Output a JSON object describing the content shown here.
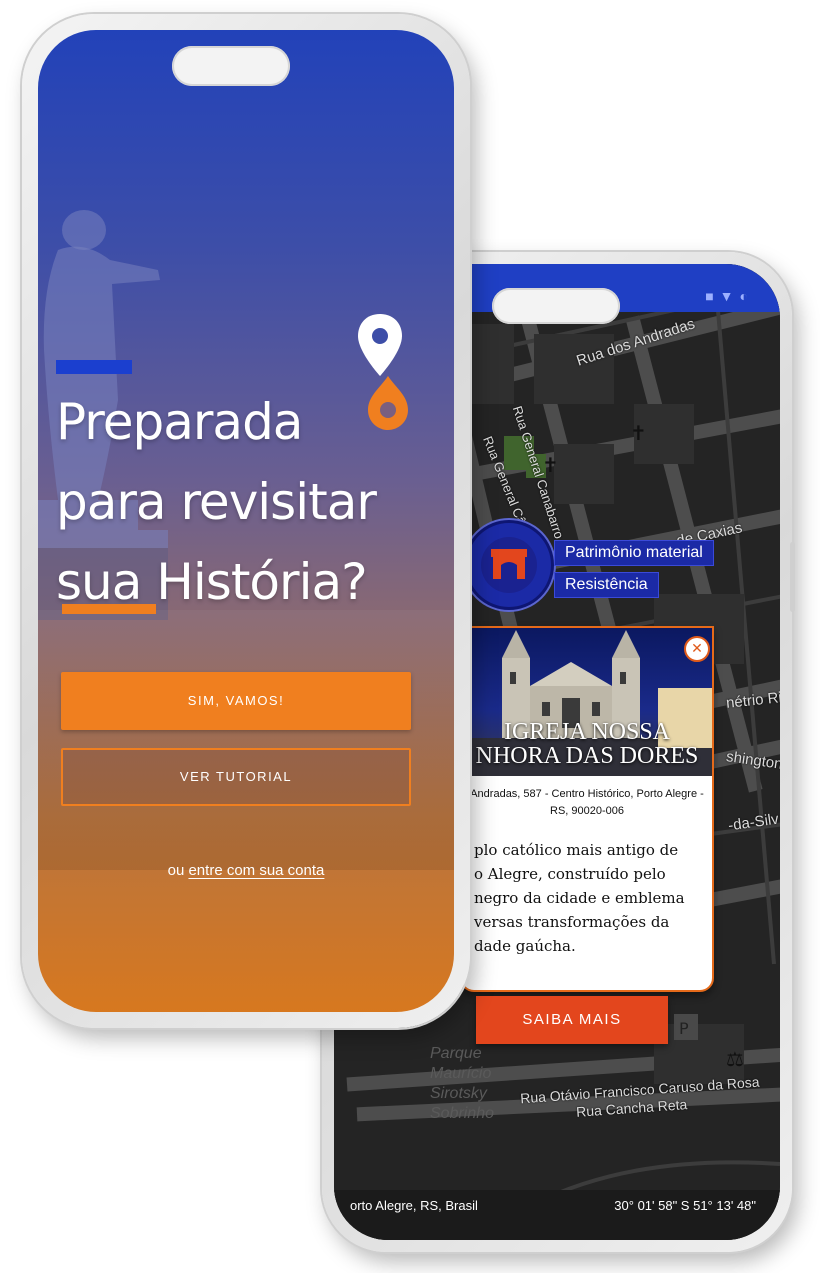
{
  "front": {
    "headline_line1": "Preparada",
    "headline_line2": "para revisitar",
    "headline_line3_a": "sua",
    "headline_line3_b": " História?",
    "primary_button": "SIM, VAMOS!",
    "secondary_button": "VER TUTORIAL",
    "login_prefix": "ou ",
    "login_link": "entre com sua conta"
  },
  "map": {
    "streets": [
      "Rua dos Andradas",
      "Rua General Canabarro",
      "Rua General Câmara",
      "de Caxias",
      "nétrio Ri",
      "shington",
      "-da-Silv",
      "Rua Otávio Francisco Caruso da Rosa",
      "Rua Cancha Reta",
      "Parque Maurício Sirotsky Sobrinho"
    ],
    "category_tags": [
      "Patrimônio material",
      "Resistência"
    ],
    "card": {
      "title_line1": "IGREJA NOSSA",
      "title_line2": "NHORA DAS DORES",
      "address": "Andradas, 587 - Centro Histórico, Porto Alegre - RS, 90020-006",
      "description": "plo católico mais antigo de\no Alegre, construído pelo\nnegro da cidade e emblema\nversas transformações da\ndade gaúcha.",
      "close_symbol": "✕"
    },
    "cta_button": "SAIBA MAIS",
    "location_label": "orto Alegre, RS, Brasil",
    "coordinates": "30° 01' 58\" S 51° 13' 48\""
  },
  "colors": {
    "brand_blue": "#1f3fc4",
    "brand_orange": "#f07f1f",
    "cta_red": "#e3461d"
  }
}
